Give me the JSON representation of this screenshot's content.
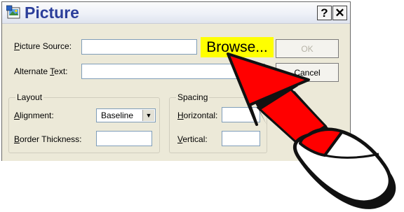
{
  "dialog": {
    "title": "Picture",
    "help_button": "?",
    "close_button": "✕"
  },
  "fields": {
    "picture_source": {
      "label_pre": "",
      "label_key": "P",
      "label_post": "icture Source:",
      "value": ""
    },
    "alternate_text": {
      "label_pre": "Alternate ",
      "label_key": "T",
      "label_post": "ext:",
      "value": ""
    }
  },
  "buttons": {
    "browse": "Browse...",
    "ok": "OK",
    "cancel": "Cancel"
  },
  "layout_group": {
    "title": "Layout",
    "alignment": {
      "label_pre": "",
      "label_key": "A",
      "label_post": "lignment:",
      "value": "Baseline"
    },
    "border_thickness": {
      "label_pre": "",
      "label_key": "B",
      "label_post": "order Thickness:",
      "value": ""
    }
  },
  "spacing_group": {
    "title": "Spacing",
    "horizontal": {
      "label_pre": "",
      "label_key": "H",
      "label_post": "orizontal:",
      "value": ""
    },
    "vertical": {
      "label_pre": "",
      "label_key": "V",
      "label_post": "ertical:",
      "value": ""
    }
  },
  "colors": {
    "highlight": "#ffff00",
    "arrow_fill": "#ff0000",
    "title_text": "#2b3e9a"
  },
  "icons": [
    "picture-app-icon",
    "help-icon",
    "close-icon",
    "dropdown-arrow-icon",
    "pointer-arrow",
    "mouse-icon"
  ]
}
